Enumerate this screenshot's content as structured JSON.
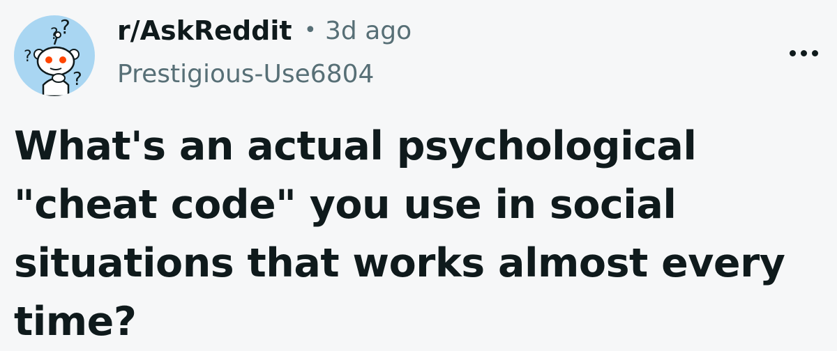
{
  "post": {
    "subreddit": "r/AskReddit",
    "separator": "•",
    "timestamp": "3d ago",
    "author": "Prestigious-Use6804",
    "title": "What's an actual psychological \"cheat code\" you use in social situations that works almost every time?",
    "avatar_icon": "thinking-snoo-icon",
    "more_icon": "more-options-icon"
  },
  "colors": {
    "background": "#f6f7f8",
    "text_primary": "#0f1a1c",
    "text_secondary": "#576f76",
    "avatar_bg": "#a9d6f2"
  }
}
